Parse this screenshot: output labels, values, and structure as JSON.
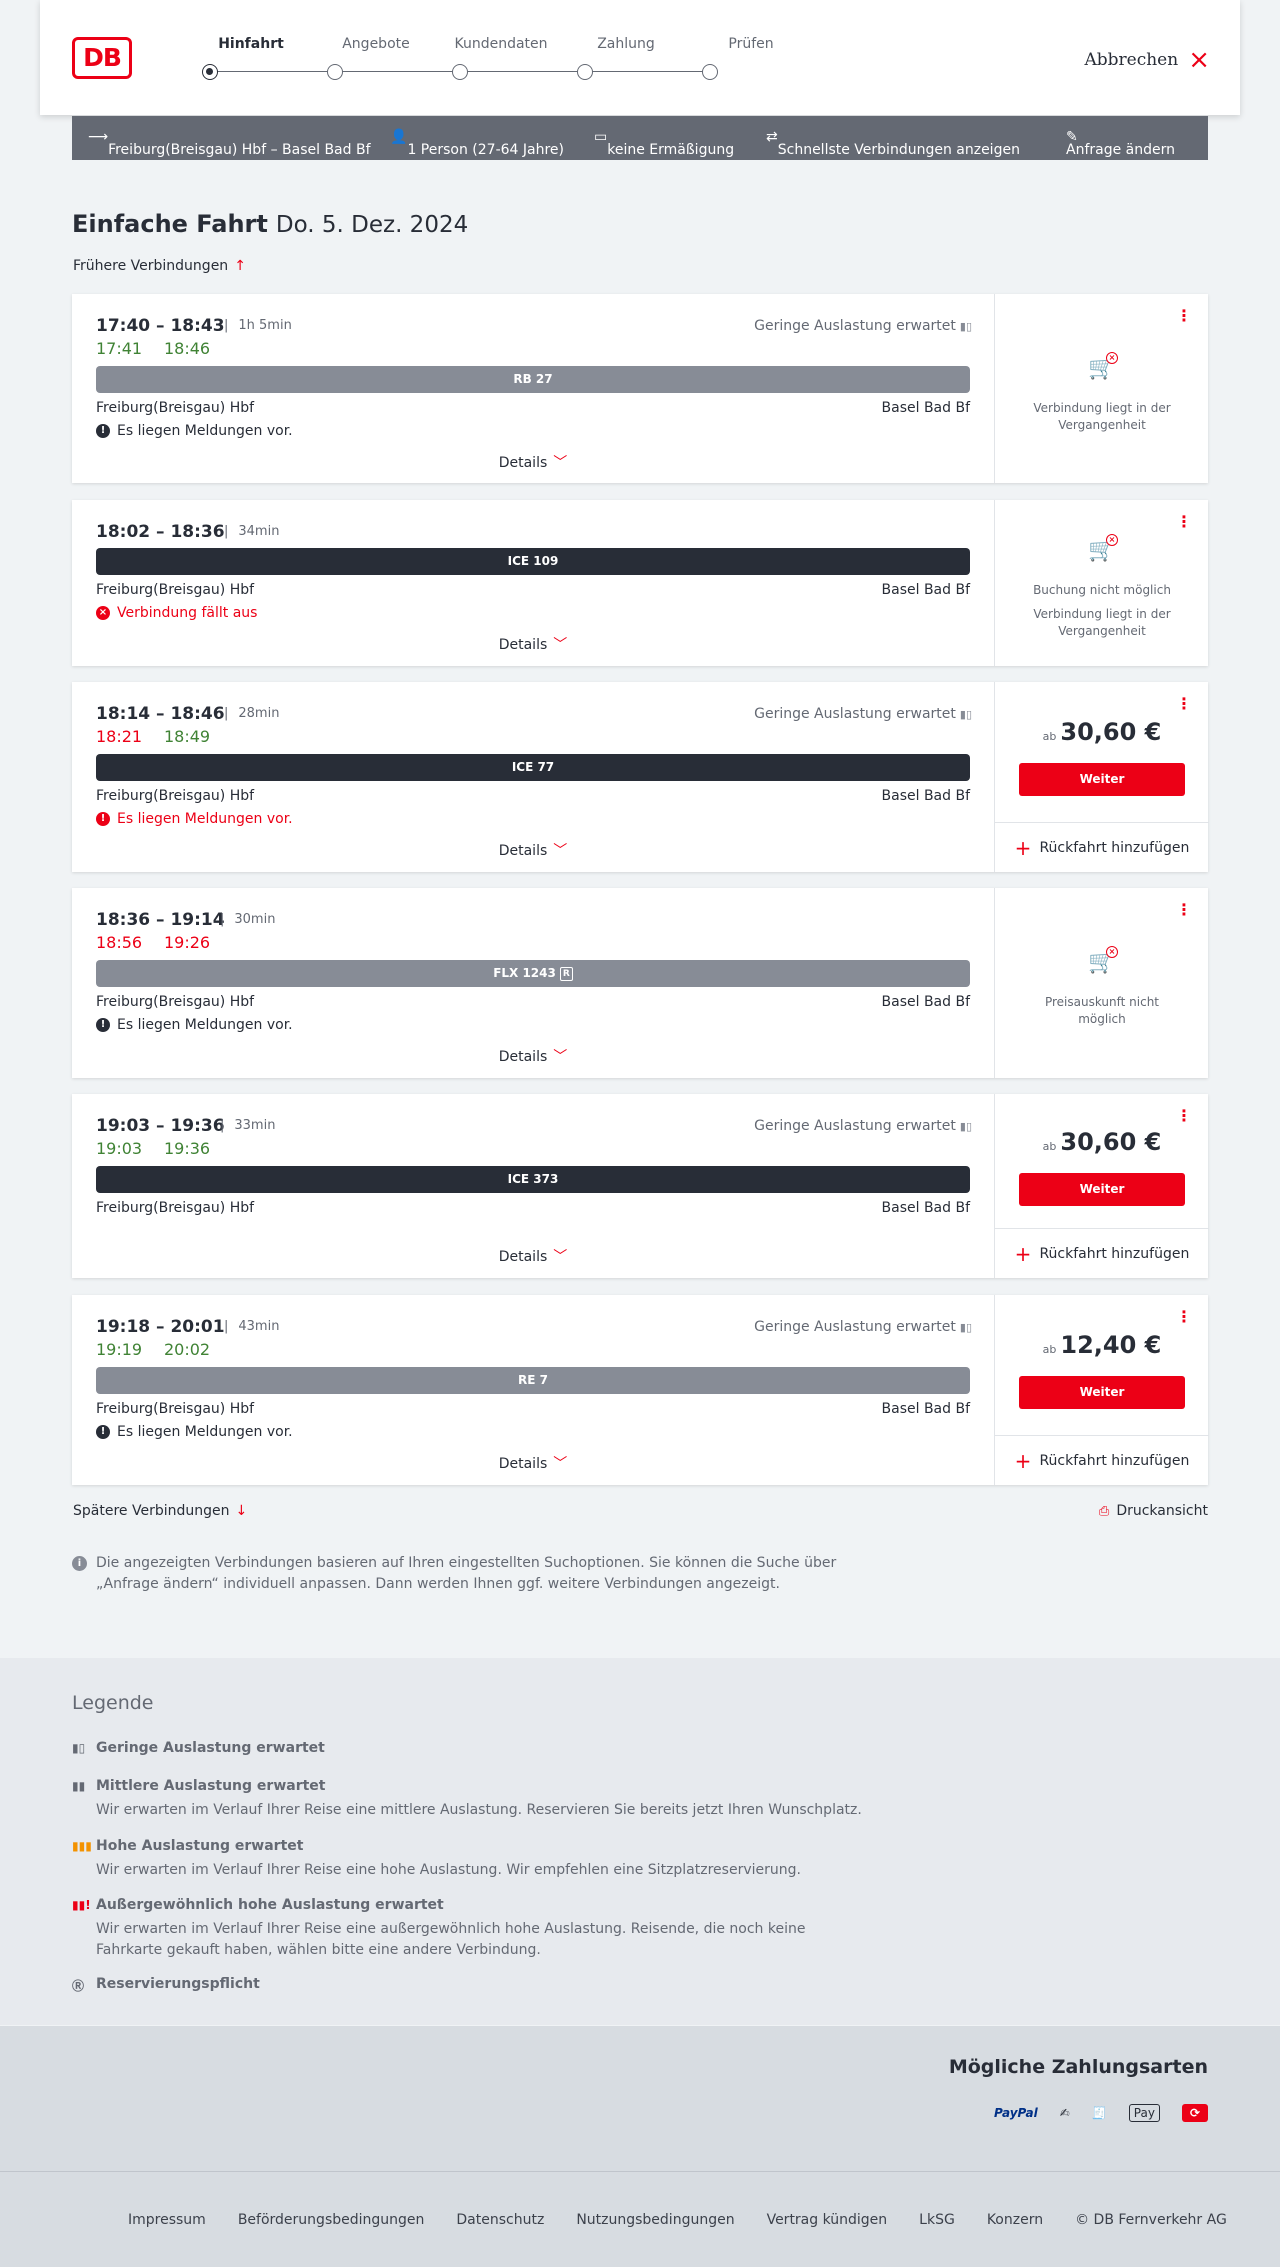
{
  "header": {
    "logo": "DB",
    "steps": [
      "Hinfahrt",
      "Angebote",
      "Kundendaten",
      "Zahlung",
      "Prüfen"
    ],
    "cancel": "Abbrechen"
  },
  "search_bar": {
    "route": "Freiburg(Breisgau) Hbf – Basel Bad Bf",
    "travellers": "1 Person (27-64 Jahre)",
    "discount": "keine Ermäßigung",
    "fastest": "Schnellste Verbindungen anzeigen",
    "change": "Anfrage ändern"
  },
  "page": {
    "title": "Einfache Fahrt",
    "date": "Do. 5. Dez. 2024",
    "earlier": "Frühere Verbindungen",
    "later": "Spätere Verbindungen",
    "print": "Druckansicht",
    "info": "Die angezeigten Verbindungen basieren auf Ihren eingestellten Suchoptionen. Sie können die Suche über „Anfrage ändern“ individuell anpassen. Dann werden Ihnen ggf. weitere Verbindungen angezeigt."
  },
  "common": {
    "details": "Details",
    "from": "Freiburg(Breisgau) Hbf",
    "to": "Basel Bad Bf",
    "occupancy": "Geringe Auslastung erwartet",
    "weiter": "Weiter",
    "return": "Rückfahrt hinzufügen",
    "ab": "ab"
  },
  "connections": [
    {
      "times": "17:40 – 18:43",
      "duration": "1h 5min",
      "rt_dep": "17:41",
      "rt_arr": "18:46",
      "train": "RB 27",
      "message": "Es liegen Meldungen vor.",
      "status1": "Verbindung liegt in der",
      "status2": "Vergangenheit"
    },
    {
      "times": "18:02 – 18:36",
      "duration": "34min",
      "train": "ICE 109",
      "message": "Verbindung fällt aus",
      "status0": "Buchung nicht möglich",
      "status1": "Verbindung liegt in der",
      "status2": "Vergangenheit"
    },
    {
      "times": "18:14 – 18:46",
      "duration": "28min",
      "rt_dep": "18:21",
      "rt_arr": "18:49",
      "train": "ICE 77",
      "message": "Es liegen Meldungen vor.",
      "price": "30,60 €"
    },
    {
      "times": "18:36 – 19:14",
      "duration": "30min",
      "rt_dep": "18:56",
      "rt_arr": "19:26",
      "train": "FLX 1243",
      "train_badge": "R",
      "message": "Es liegen Meldungen vor.",
      "status1": "Preisauskunft nicht",
      "status2": "möglich"
    },
    {
      "times": "19:03 – 19:36",
      "duration": "33min",
      "rt_dep": "19:03",
      "rt_arr": "19:36",
      "train": "ICE 373",
      "price": "30,60 €"
    },
    {
      "times": "19:18 – 20:01",
      "duration": "43min",
      "rt_dep": "19:19",
      "rt_arr": "20:02",
      "train": "RE 7",
      "message": "Es liegen Meldungen vor.",
      "price": "12,40 €"
    }
  ],
  "legend": {
    "title": "Legende",
    "items": [
      {
        "title": "Geringe Auslastung erwartet",
        "desc": ""
      },
      {
        "title": "Mittlere Auslastung erwartet",
        "desc": "Wir erwarten im Verlauf Ihrer Reise eine mittlere Auslastung. Reservieren Sie bereits jetzt Ihren Wunschplatz."
      },
      {
        "title": "Hohe Auslastung erwartet",
        "desc": "Wir erwarten im Verlauf Ihrer Reise eine hohe Auslastung. Wir empfehlen eine Sitzplatzreservierung."
      },
      {
        "title": "Außergewöhnlich hohe Auslastung erwartet",
        "desc": "Wir erwarten im Verlauf Ihrer Reise eine außergewöhnlich hohe Auslastung. Reisende, die noch keine Fahrkarte gekauft haben, wählen bitte eine andere Verbindung."
      },
      {
        "title": "Reservierungspflicht",
        "desc": ""
      }
    ]
  },
  "payment": {
    "title": "Mögliche Zahlungsarten",
    "paypal": "PayPal",
    "applepay": "Pay"
  },
  "footer": [
    "Impressum",
    "Beförderungsbedingungen",
    "Datenschutz",
    "Nutzungsbedingungen",
    "Vertrag kündigen",
    "LkSG",
    "Konzern",
    "© DB Fernverkehr AG"
  ],
  "colors": {
    "brand": "#ec0016",
    "ontime": "#408335",
    "delay": "#ec0016",
    "bar": "#646973"
  }
}
